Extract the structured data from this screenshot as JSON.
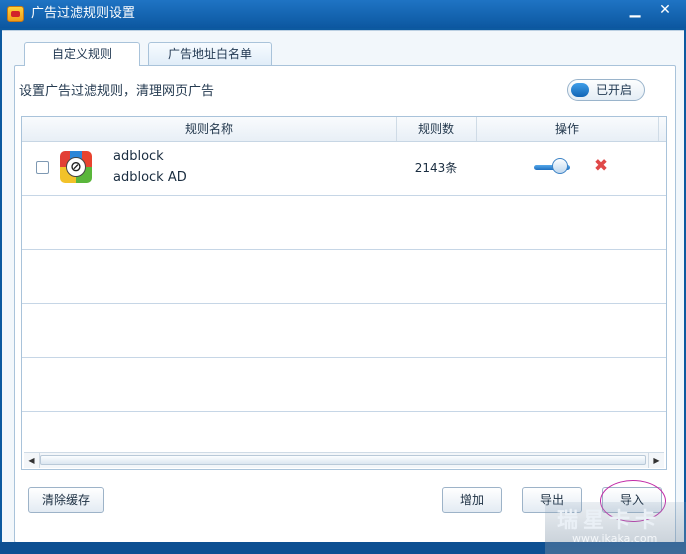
{
  "window": {
    "title": "广告过滤规则设置",
    "minimize_glyph": "▁",
    "close_glyph": "✕"
  },
  "tabs": [
    {
      "label": "自定义规则",
      "active": true
    },
    {
      "label": "广告地址白名单",
      "active": false
    }
  ],
  "description": "设置广告过滤规则，清理网页广告",
  "toggle": {
    "label": "已开启",
    "on": true
  },
  "table": {
    "headers": {
      "name": "规则名称",
      "count": "规则数",
      "action": "操作"
    },
    "rows": [
      {
        "name": "adblock",
        "subtitle": "adblock AD",
        "count": "2143条",
        "enabled": true,
        "checked": false
      }
    ]
  },
  "buttons": {
    "clear_cache": "清除缓存",
    "add": "增加",
    "export": "导出",
    "import": "导入"
  },
  "watermark": {
    "text": "瑞星卡卡",
    "url": "www.ikaka.com"
  },
  "icons": {
    "app": "rising-app-icon",
    "rule": "adblock-rule-icon",
    "delete": "delete-x-icon"
  },
  "colors": {
    "titlebar": "#1a6cbd",
    "accent": "#1e6ec2",
    "delete": "#e04848",
    "highlight_circle": "#c22aa7"
  }
}
